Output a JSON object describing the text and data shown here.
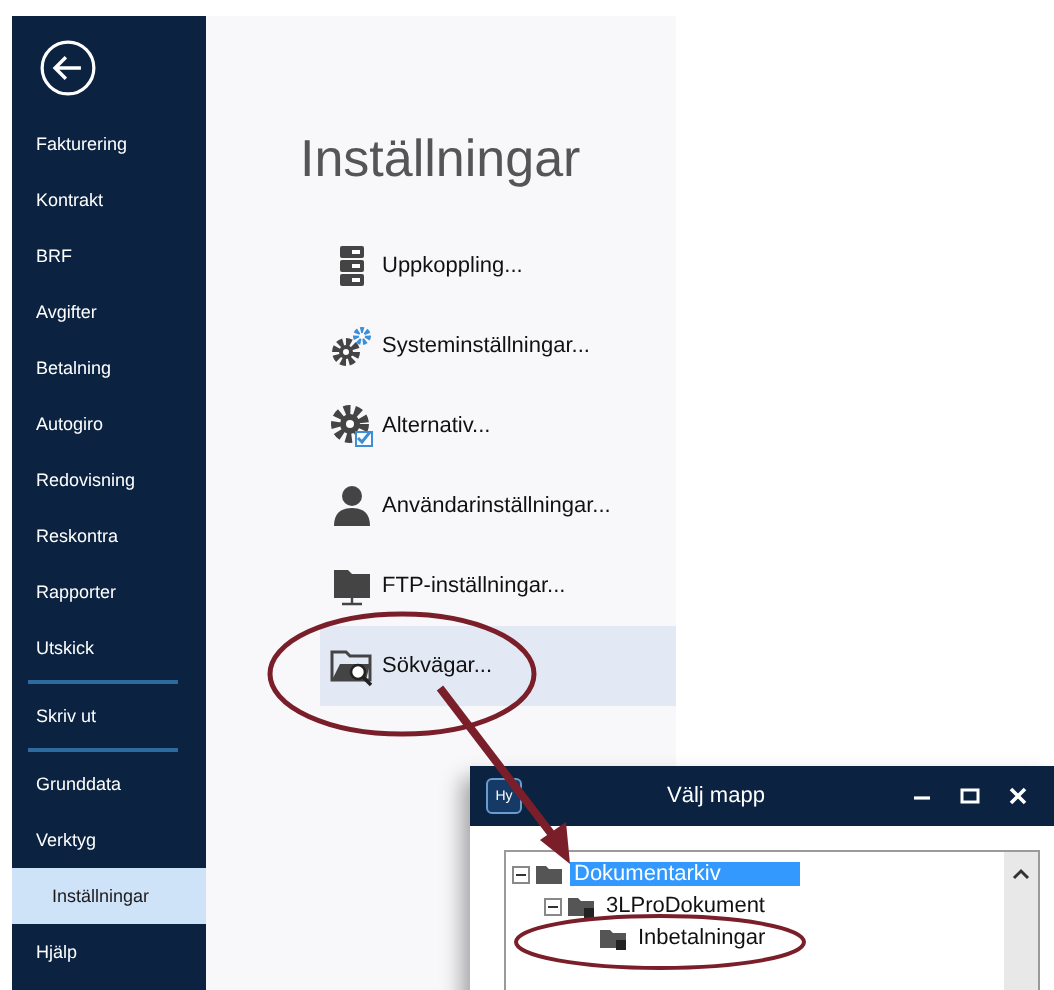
{
  "sidebar": {
    "groups": [
      [
        {
          "label": "Fakturering",
          "selected": false
        },
        {
          "label": "Kontrakt",
          "selected": false
        },
        {
          "label": "BRF",
          "selected": false
        },
        {
          "label": "Avgifter",
          "selected": false
        },
        {
          "label": "Betalning",
          "selected": false
        },
        {
          "label": "Autogiro",
          "selected": false
        },
        {
          "label": "Redovisning",
          "selected": false
        },
        {
          "label": "Reskontra",
          "selected": false
        },
        {
          "label": "Rapporter",
          "selected": false
        },
        {
          "label": "Utskick",
          "selected": false
        }
      ],
      [
        {
          "label": "Skriv ut",
          "selected": false
        }
      ],
      [
        {
          "label": "Grunddata",
          "selected": false
        },
        {
          "label": "Verktyg",
          "selected": false
        },
        {
          "label": "Inställningar",
          "selected": true
        },
        {
          "label": "Hjälp",
          "selected": false
        }
      ]
    ]
  },
  "main": {
    "title": "Inställningar",
    "items": [
      {
        "kind": "server",
        "label": "Uppkoppling...",
        "selected": false
      },
      {
        "kind": "gears",
        "label": "Systeminställningar...",
        "selected": false
      },
      {
        "kind": "gear-check",
        "label": "Alternativ...",
        "selected": false
      },
      {
        "kind": "user",
        "label": "Användarinställningar...",
        "selected": false
      },
      {
        "kind": "ftp",
        "label": "FTP-inställningar...",
        "selected": false
      },
      {
        "kind": "search-folder",
        "label": "Sökvägar...",
        "selected": true
      }
    ]
  },
  "dialog": {
    "logo": "Hy",
    "title": "Välj mapp",
    "tree": [
      {
        "label": "Dokumentarkiv",
        "selected": true,
        "expanded": true,
        "locked": false,
        "children": [
          {
            "label": "3LProDokument",
            "selected": false,
            "expanded": true,
            "locked": true,
            "children": [
              {
                "label": "Inbetalningar",
                "selected": false,
                "locked": true
              }
            ]
          }
        ]
      }
    ]
  }
}
